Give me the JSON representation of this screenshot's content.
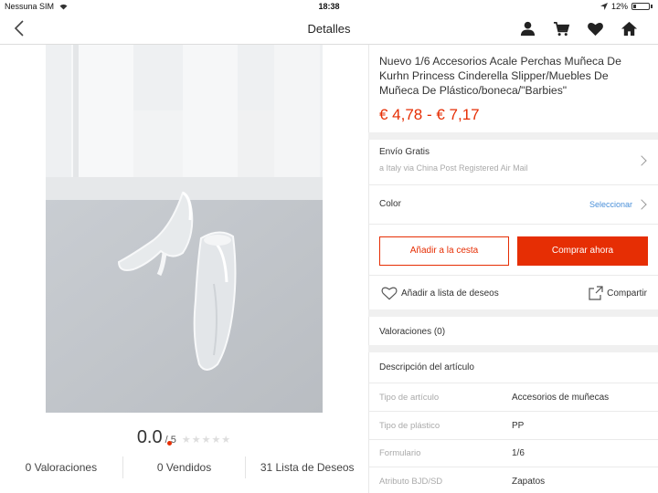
{
  "status_bar": {
    "carrier": "Nessuna SIM",
    "time": "18:38",
    "battery": "12%"
  },
  "nav": {
    "title": "Detalles",
    "icons": [
      "back-icon",
      "user-icon",
      "cart-icon",
      "heart-icon",
      "home-icon"
    ]
  },
  "gallery": {
    "image_count": 4,
    "active_index": 0
  },
  "rating": {
    "score": "0.0",
    "max": "/ 5",
    "stars_filled": 0,
    "stars_total": 5
  },
  "stats": {
    "reviews": "0 Valoraciones",
    "sold": "0 Vendidos",
    "wishlist": "31 Lista de Deseos"
  },
  "product": {
    "title": "Nuevo 1/6 Accesorios Acale Perchas Muñeca De Kurhn Princess Cinderella Slipper/Muebles De Muñeca De Plástico/boneca/\"Barbies\"",
    "price": "€ 4,78 - € 7,17"
  },
  "shipping": {
    "label": "Envío Gratis",
    "detail": "a Italy via China Post Registered Air Mail"
  },
  "color": {
    "label": "Color",
    "action": "Seleccionar"
  },
  "actions": {
    "add_to_cart": "Añadir a la cesta",
    "buy_now": "Comprar ahora",
    "wishlist": "Añadir a lista de deseos",
    "share": "Compartir"
  },
  "reviews_section": {
    "label": "Valoraciones (0)"
  },
  "description": {
    "header": "Descripción del artículo",
    "specs": [
      {
        "label": "Tipo de artículo",
        "value": "Accesorios de muñecas"
      },
      {
        "label": "Tipo de plástico",
        "value": "PP"
      },
      {
        "label": "Formulario",
        "value": "1/6"
      },
      {
        "label": "Atributo BJD/SD",
        "value": "Zapatos"
      }
    ]
  },
  "colors": {
    "accent": "#e62e04",
    "link": "#4a90d9"
  }
}
